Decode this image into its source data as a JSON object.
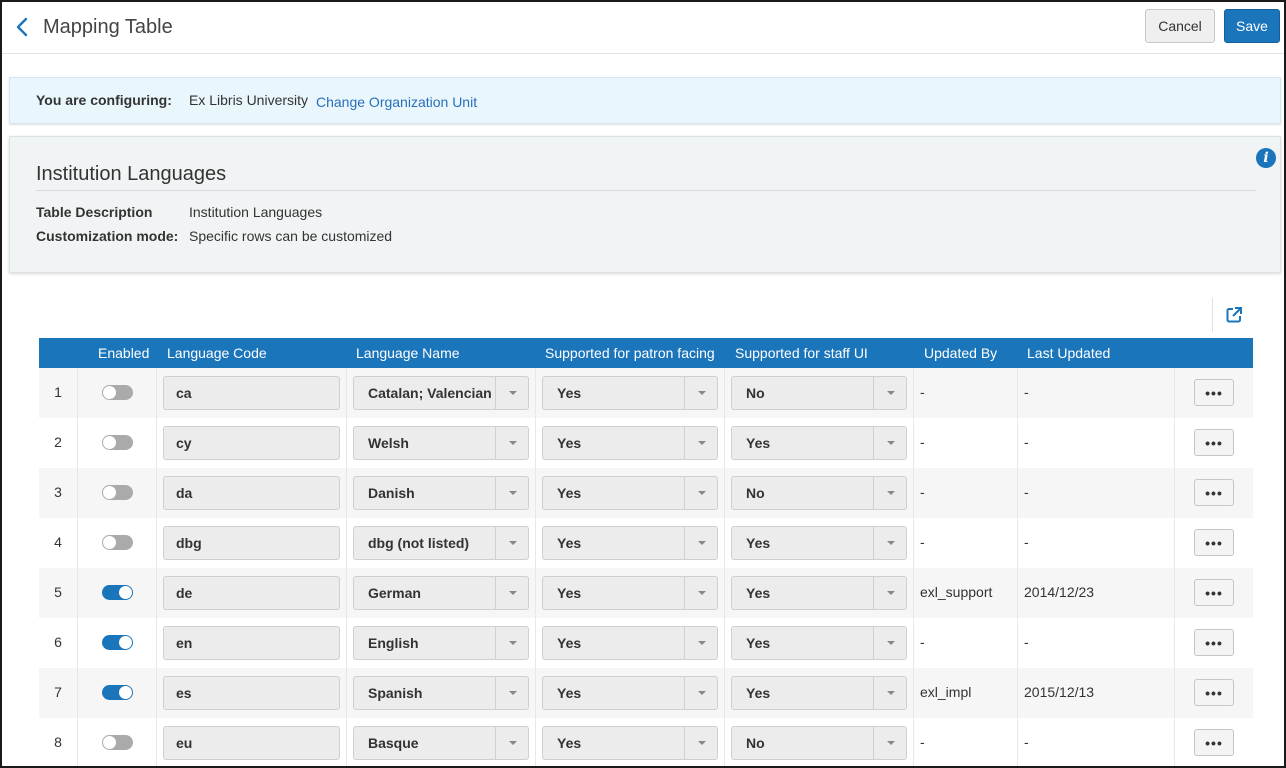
{
  "header": {
    "title": "Mapping Table",
    "cancel_label": "Cancel",
    "save_label": "Save"
  },
  "config": {
    "label": "You are configuring:",
    "value": "Ex Libris University",
    "link": "Change Organization Unit"
  },
  "panel": {
    "title": "Institution Languages",
    "description_label": "Table Description",
    "description_value": "Institution Languages",
    "mode_label": "Customization mode:",
    "mode_value": "Specific rows can be customized"
  },
  "colors": {
    "accent": "#1b75bb",
    "config_bg": "#e9f7fc",
    "panel_bg": "#f1f4f4",
    "toggle_off": "#aaaaaa"
  },
  "table": {
    "columns": [
      "Enabled",
      "Language Code",
      "Language Name",
      "Supported for patron facing",
      "Supported for staff UI",
      "Updated By",
      "Last Updated"
    ],
    "rows": [
      {
        "num": "1",
        "enabled": false,
        "code": "ca",
        "name": "Catalan; Valencian",
        "patron": "Yes",
        "staff": "No",
        "updated_by": "-",
        "last_updated": "-"
      },
      {
        "num": "2",
        "enabled": false,
        "code": "cy",
        "name": "Welsh",
        "patron": "Yes",
        "staff": "Yes",
        "updated_by": "-",
        "last_updated": "-"
      },
      {
        "num": "3",
        "enabled": false,
        "code": "da",
        "name": "Danish",
        "patron": "Yes",
        "staff": "No",
        "updated_by": "-",
        "last_updated": "-"
      },
      {
        "num": "4",
        "enabled": false,
        "code": "dbg",
        "name": "dbg (not listed)",
        "patron": "Yes",
        "staff": "Yes",
        "updated_by": "-",
        "last_updated": "-"
      },
      {
        "num": "5",
        "enabled": true,
        "code": "de",
        "name": "German",
        "patron": "Yes",
        "staff": "Yes",
        "updated_by": "exl_support",
        "last_updated": "2014/12/23"
      },
      {
        "num": "6",
        "enabled": true,
        "code": "en",
        "name": "English",
        "patron": "Yes",
        "staff": "Yes",
        "updated_by": "-",
        "last_updated": "-"
      },
      {
        "num": "7",
        "enabled": true,
        "code": "es",
        "name": "Spanish",
        "patron": "Yes",
        "staff": "Yes",
        "updated_by": "exl_impl",
        "last_updated": "2015/12/13"
      },
      {
        "num": "8",
        "enabled": false,
        "code": "eu",
        "name": "Basque",
        "patron": "Yes",
        "staff": "No",
        "updated_by": "-",
        "last_updated": "-"
      }
    ],
    "more_label": "•••"
  },
  "icons": {
    "back": "chevron-left-icon",
    "info": "info-icon",
    "export": "external-link-icon",
    "more": "ellipsis-icon"
  }
}
